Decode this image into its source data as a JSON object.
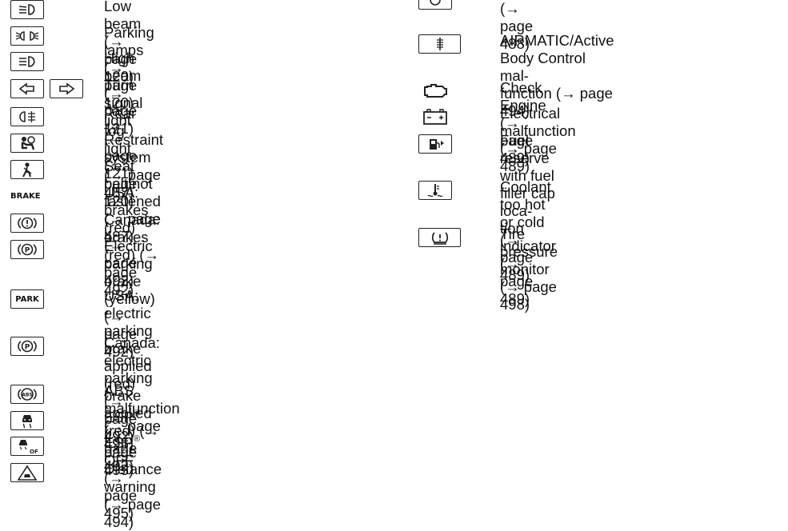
{
  "left_items": [
    {
      "icon": "low-beam-icon",
      "lines": [
        "Low beam (→ page 120)"
      ]
    },
    {
      "icon": "parking-lamps-icon",
      "lines": [
        "Parking lamps (→ page 120)"
      ]
    },
    {
      "icon": "high-beam-icon",
      "lines": [
        "High beam (→ page 121)"
      ]
    },
    {
      "icon": "turn-signal-icon",
      "lines": [
        "Turn signal light (→ page 121)"
      ]
    },
    {
      "icon": "rear-fog-light-icon",
      "lines": [
        "Rear fog light (→ page 120)"
      ]
    },
    {
      "icon": "restraint-system-icon",
      "lines": [
        "Restraint system (→ page 487)"
      ]
    },
    {
      "icon": "seat-belt-icon",
      "lines": [
        "Seat belt not fastened (→ page 487)"
      ]
    },
    {
      "icon": "brake-icon",
      "icon_text": "BRAKE",
      "lines": [
        "USA: brakes (red) (→ page 492)"
      ]
    },
    {
      "icon": "brake-circle-icon",
      "icon_text": "(!)",
      "lines": [
        "Canada: brakes (red) (→ page 492)"
      ]
    },
    {
      "icon": "parking-brake-icon",
      "icon_text": "(P)",
      "lines": [
        "Electric parking brake (yellow)",
        "(→ page 492)"
      ]
    },
    {
      "icon": "park-icon",
      "icon_text": "PARK",
      "lines": [
        "USA: electric parking brake applied",
        "(red) (→ page 492)"
      ]
    },
    {
      "icon": "parking-brake-icon",
      "icon_text": "(P)",
      "lines": [
        "Canada: electric parking brake",
        "applied (red) (→ page 492)"
      ]
    },
    {
      "icon": "abs-icon",
      "icon_text": "ABS",
      "lines": [
        "ABS malfunction (→ page 495)"
      ]
    },
    {
      "icon": "esp-icon",
      "lines": [
        "ESP",
        "(→ page 495)"
      ],
      "sup": "®"
    },
    {
      "icon": "esp-off-icon",
      "lines": [
        "ESP",
        "OFF (→ page 495)"
      ],
      "sup": "®"
    },
    {
      "icon": "distance-warning-icon",
      "lines": [
        "Distance warning (→ page 494)"
      ]
    }
  ],
  "right_items": [
    {
      "icon": "partial-icon",
      "lines": [
        "(→ page 488)"
      ]
    },
    {
      "icon": "airmatic-icon",
      "lines": [
        "AIRMATIC/Active Body Control mal-",
        "function (→ page 494)"
      ]
    },
    {
      "icon": "check-engine-icon",
      "lines": [
        "Check Engine (→ page 489)"
      ]
    },
    {
      "icon": "battery-icon",
      "lines": [
        "Electrical malfunction (→ page 489)"
      ]
    },
    {
      "icon": "fuel-reserve-icon",
      "lines": [
        "Fuel reserve with fuel filler cap loca-",
        "tion indicator (→ page 489)"
      ]
    },
    {
      "icon": "coolant-icon",
      "lines": [
        "Coolant too hot or cold",
        "(→ page 489)"
      ]
    },
    {
      "icon": "tire-pressure-icon",
      "icon_text": "(!)",
      "lines": [
        "Tire pressure monitor (→ page 498)"
      ]
    }
  ]
}
